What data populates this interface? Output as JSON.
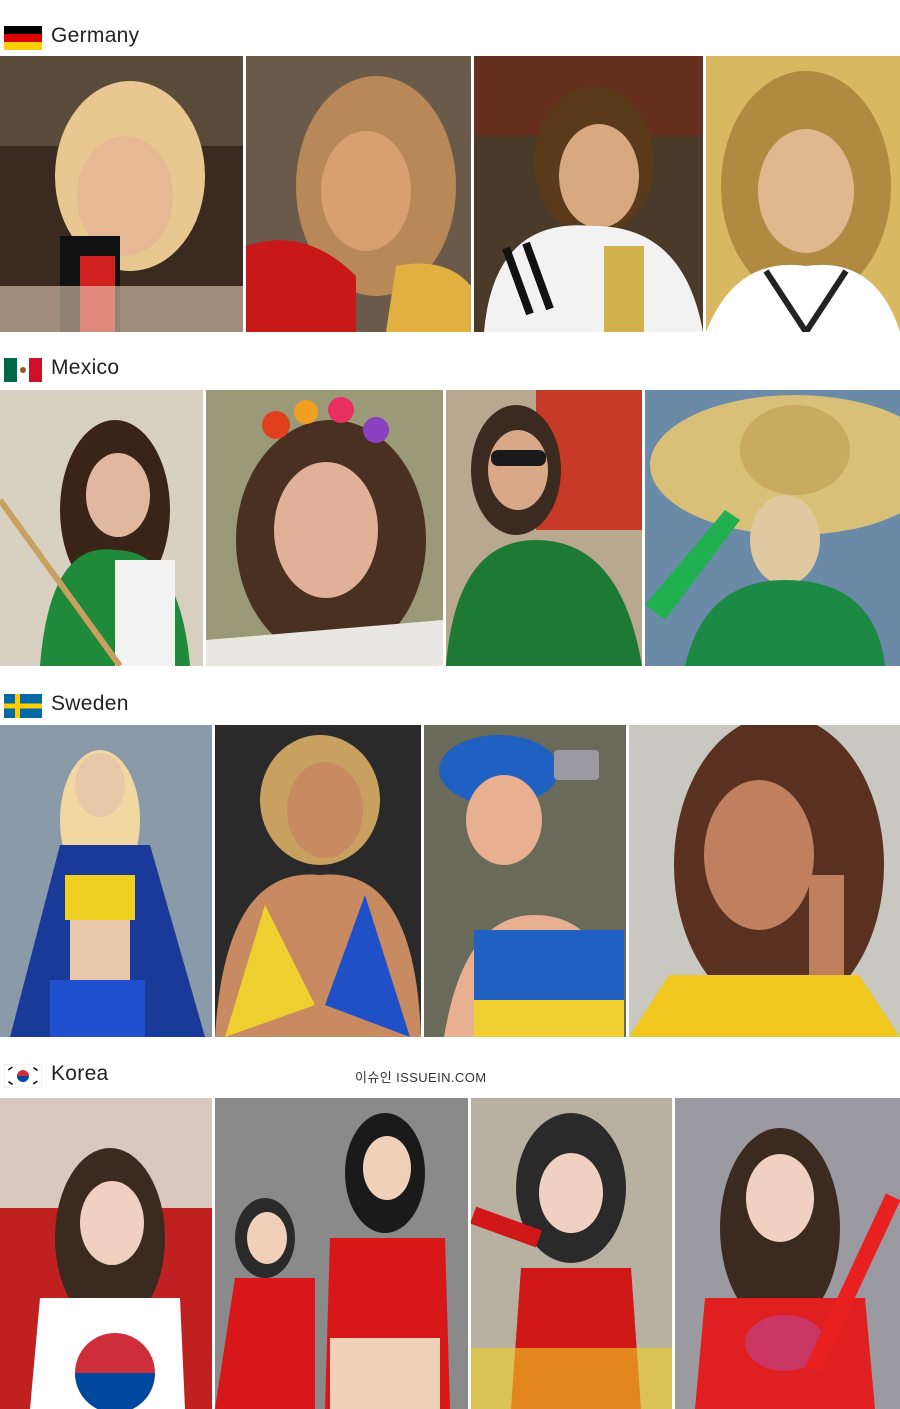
{
  "sections": [
    {
      "country": "Germany",
      "flag_icon": "germany-flag-icon",
      "photos": [
        {
          "subject": "blonde fan with face paint holding flag",
          "palette": [
            "#3b2a20",
            "#e8c890",
            "#111111",
            "#d02020"
          ]
        },
        {
          "subject": "fan with feather boa and flag stripes on cheeks",
          "palette": [
            "#6a5a4a",
            "#d8a070",
            "#c81818",
            "#e0b040"
          ]
        },
        {
          "subject": "fan in white jersey looking up",
          "palette": [
            "#5a3a1a",
            "#d8a880",
            "#f2f2f2",
            "#c8a020"
          ]
        },
        {
          "subject": "fan in Germany jersey",
          "palette": [
            "#b08a40",
            "#e0b890",
            "#ffffff",
            "#222222"
          ]
        }
      ]
    },
    {
      "country": "Mexico",
      "flag_icon": "mexico-flag-icon",
      "photos": [
        {
          "subject": "fan in green and white shirt holding stick",
          "palette": [
            "#d8d0c0",
            "#e0b8a0",
            "#1f8a3a",
            "#3a2418"
          ]
        },
        {
          "subject": "fan with flower crown",
          "palette": [
            "#9a9a78",
            "#e0b098",
            "#e04020",
            "#4a3020"
          ]
        },
        {
          "subject": "fan with sunglasses in green jersey",
          "palette": [
            "#c83a28",
            "#d8a888",
            "#1c7a34",
            "#3a2a20"
          ]
        },
        {
          "subject": "fan wearing sombrero with vuvuzela",
          "palette": [
            "#6a8aa8",
            "#e0c8a0",
            "#1c8a44",
            "#d8c078"
          ]
        }
      ]
    },
    {
      "country": "Sweden",
      "flag_icon": "sweden-flag-icon",
      "photos": [
        {
          "subject": "blonde fan with flower crown wrapped in flag",
          "palette": [
            "#8a9aa8",
            "#e8c8a8",
            "#f0d020",
            "#1a3a9a"
          ]
        },
        {
          "subject": "fan with flag painted on cheeks in bikini top",
          "palette": [
            "#2a2a2a",
            "#c88a60",
            "#f0d030",
            "#2050c8"
          ]
        },
        {
          "subject": "fan with camera in blue hat",
          "palette": [
            "#6a6a5a",
            "#e8b090",
            "#2060c0",
            "#f0d030"
          ]
        },
        {
          "subject": "fan with long brown hair",
          "palette": [
            "#c8c8c0",
            "#c08060",
            "#5a3020",
            "#f0c820"
          ]
        }
      ]
    },
    {
      "country": "Korea",
      "flag_icon": "korea-flag-icon",
      "watermark": "이슈인 ISSUEIN.COM",
      "photos": [
        {
          "subject": "fan wrapped in Korean flag",
          "palette": [
            "#c02020",
            "#f0d0c0",
            "#ffffff",
            "#3a2a20"
          ]
        },
        {
          "subject": "fans with devil horns in red jerseys",
          "palette": [
            "#8a8a8a",
            "#f0d0b8",
            "#d81818",
            "#1a1a1a"
          ]
        },
        {
          "subject": "fan with devil horns in red top",
          "palette": [
            "#b8b0a0",
            "#f0d0c0",
            "#d01818",
            "#2a2a2a"
          ]
        },
        {
          "subject": "fan with flag sticker holding cheer stick",
          "palette": [
            "#9a9aa0",
            "#f0d0c0",
            "#e02020",
            "#3a2a20"
          ]
        }
      ]
    }
  ]
}
